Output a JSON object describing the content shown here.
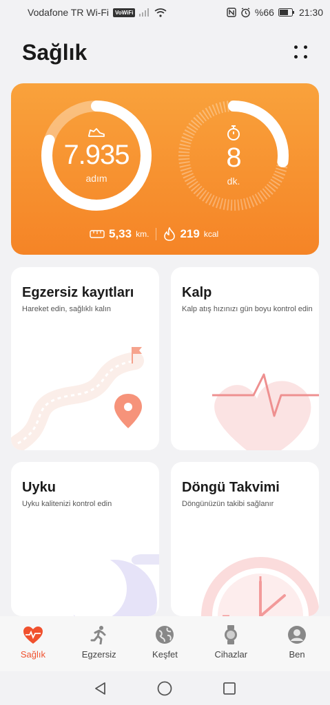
{
  "status_bar": {
    "carrier": "Vodafone TR Wi-Fi",
    "vowifi": "VoWiFi",
    "battery": "%66",
    "time": "21:30"
  },
  "header": {
    "title": "Sağlık"
  },
  "activity": {
    "steps_value": "7.935",
    "steps_unit": "adım",
    "steps_progress": 0.8,
    "minutes_value": "8",
    "minutes_unit": "dk.",
    "minutes_progress": 0.27,
    "distance_value": "5,33",
    "distance_unit": "km.",
    "calories_value": "219",
    "calories_unit": "kcal"
  },
  "tiles": [
    {
      "title": "Egzersiz kayıtları",
      "subtitle": "Hareket edin, sağlıklı kalın"
    },
    {
      "title": "Kalp",
      "subtitle": "Kalp atış hızınızı gün boyu kontrol edin"
    },
    {
      "title": "Uyku",
      "subtitle": "Uyku kalitenizi kontrol edin"
    },
    {
      "title": "Döngü Takvimi",
      "subtitle": "Döngünüzün takibi sağlanır"
    }
  ],
  "bottom_nav": [
    {
      "label": "Sağlık",
      "icon": "heart-pulse-icon",
      "active": true
    },
    {
      "label": "Egzersiz",
      "icon": "runner-icon",
      "active": false
    },
    {
      "label": "Keşfet",
      "icon": "globe-icon",
      "active": false
    },
    {
      "label": "Cihazlar",
      "icon": "watch-icon",
      "active": false
    },
    {
      "label": "Ben",
      "icon": "user-icon",
      "active": false
    }
  ],
  "colors": {
    "accent": "#f0512e",
    "card_orange_top": "#f9a23c",
    "card_orange_bottom": "#f58426"
  }
}
